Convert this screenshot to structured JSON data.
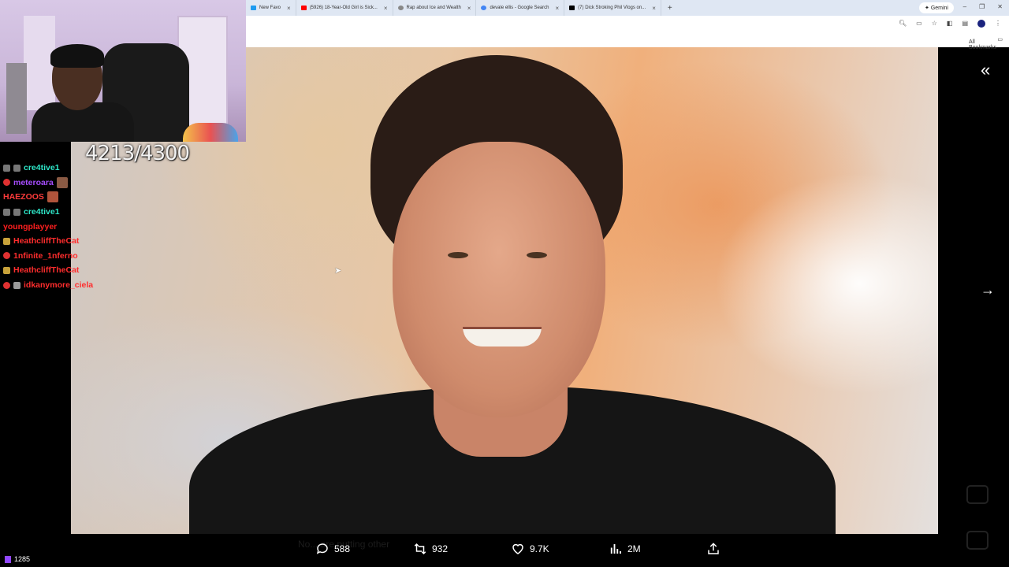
{
  "browser": {
    "tabs": [
      {
        "title": "New Favo",
        "color": "#1d9bf0"
      },
      {
        "title": "(5926) 18-Year-Old Girl is Sick...",
        "color": "#ff0000"
      },
      {
        "title": "Rap about Ice and Wealth",
        "color": "#888888"
      },
      {
        "title": "devale ellis - Google Search",
        "color": "#4285f4"
      },
      {
        "title": "(7) Dick Stroking Phil Vlogs on...",
        "color": "#000000"
      }
    ],
    "new_tab": "+",
    "gemini_label": "Gemini",
    "bookmarks_label": "All Bookmarks"
  },
  "media_viewer": {
    "collapse_icon": "double-chevron-left-icon",
    "next_icon": "arrow-right-icon"
  },
  "actions": {
    "replies": "588",
    "reposts": "932",
    "likes": "9.7K",
    "views": "2M"
  },
  "background_ghost_text": {
    "left": "No... are putting other",
    "right": ""
  },
  "stream": {
    "goal_counter": "4213/4300",
    "viewer_count": "1285",
    "chat": [
      {
        "user": "cre4tive1",
        "color": "#2ee6c8",
        "badges": [
          "#777",
          "#777"
        ],
        "text": ""
      },
      {
        "user": "meteroara",
        "color": "#a64dff",
        "badges": [
          "#e03131"
        ],
        "text": ""
      },
      {
        "user": "HAEZOOS",
        "color": "#ff3b3b",
        "badges": [],
        "text": ""
      },
      {
        "user": "cre4tive1",
        "color": "#2ee6c8",
        "badges": [
          "#777",
          "#777"
        ],
        "text": ""
      },
      {
        "user": "youngplayyer",
        "color": "#ff1f1f",
        "badges": [],
        "text": ""
      },
      {
        "user": "HeathcliffTheCat",
        "color": "#ff2d2d",
        "badges": [
          "#c8a23a"
        ],
        "text": ""
      },
      {
        "user": "1nfinite_1nferno",
        "color": "#ff2d2d",
        "badges": [
          "#e03131"
        ],
        "text": ""
      },
      {
        "user": "HeathcliffTheCat",
        "color": "#ff2d2d",
        "badges": [
          "#c8a23a"
        ],
        "text": ""
      },
      {
        "user": "idkanymore_ciela",
        "color": "#ff2d2d",
        "badges": [
          "#e03131",
          "#999"
        ],
        "text": ""
      }
    ]
  }
}
